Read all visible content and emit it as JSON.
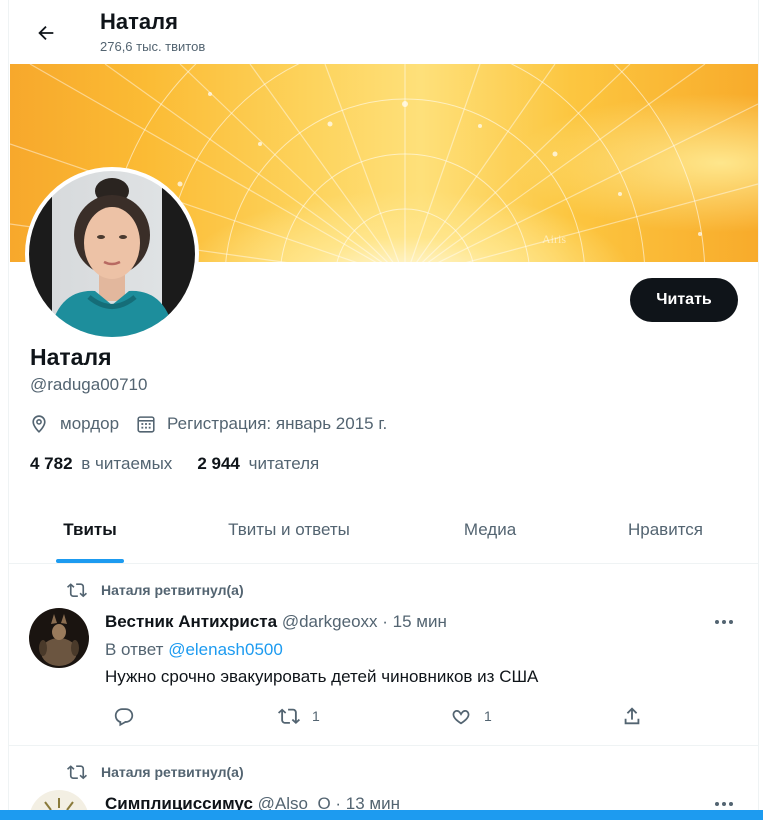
{
  "header": {
    "name": "Наталя",
    "tweet_count": "276,6 тыс. твитов"
  },
  "banner": {
    "watermark": "Airis"
  },
  "profile": {
    "name": "Наталя",
    "handle": "@raduga00710",
    "location": "мордор",
    "joined": "Регистрация: январь 2015 г.",
    "following_count": "4 782",
    "following_label": "в читаемых",
    "followers_count": "2 944",
    "followers_label": "читателя",
    "follow_button": "Читать"
  },
  "tabs": [
    {
      "label": "Твиты",
      "active": true
    },
    {
      "label": "Твиты и ответы",
      "active": false
    },
    {
      "label": "Медиа",
      "active": false
    },
    {
      "label": "Нравится",
      "active": false
    }
  ],
  "tweets": [
    {
      "retweeted_by": "Наталя ретвитнул(а)",
      "author": "Вестник Антихриста",
      "handle": "@darkgeoxx",
      "time": "· 15 мин",
      "reply_prefix": "В ответ",
      "reply_to": "@elenash0500",
      "text": "Нужно срочно эвакуировать детей чиновников из США",
      "retweets": "1",
      "likes": "1"
    },
    {
      "retweeted_by": "Наталя ретвитнул(а)",
      "author": "Симплициссимус",
      "handle": "@Also_O",
      "time": "· 13 мин"
    }
  ],
  "colors": {
    "accent": "#1d9bf0",
    "text": "#0f1419",
    "secondary": "#536471"
  }
}
